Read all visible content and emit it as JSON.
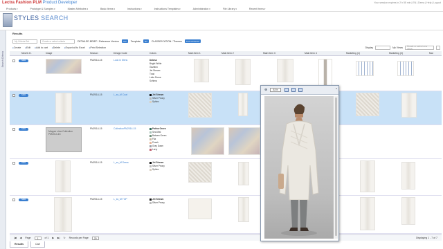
{
  "app": {
    "brand": "Lectra Fashion PLM",
    "product": "Product Developer",
    "top_links": "Your session expires in 2 h 55 min  |  EN  |  Demo  |  Help  |  Logout"
  },
  "menu": [
    "Products",
    "Prototype & Samples",
    "Master Attributes",
    "Basic Items",
    "Instructions",
    "Instructions Templates",
    "Administration",
    "File Library",
    "Recent Items"
  ],
  "page": {
    "title_a": "STYLES",
    "title_b": "SEARCH",
    "results_label": "Results",
    "sidebar_label": "Search Criteria"
  },
  "filters": {
    "criteria_placeholder": "My Criteria Set",
    "select_placeholder": "Create or select criteria",
    "brief_label": "DETAILED BRIEF / Reference Version",
    "brief_badge": "Yes",
    "template_label": "Template",
    "template_badge": "No",
    "classification_label": "CLASSIFICATION / Themes",
    "classification_badge": "Look at theme"
  },
  "toolbar": [
    "Create",
    "Edit",
    "Add to cart",
    "Delete",
    "Export all to Excel",
    "Print Selection"
  ],
  "right_controls": {
    "display": "Display",
    "my_views": "My Views",
    "views_placeholder": "Create or select new views"
  },
  "columns": [
    "New/C.D.",
    "Image",
    "Season",
    "Design Code",
    "Colors",
    "Main Item 1",
    "Main Item 2",
    "Main Item 3",
    "Main Item 4",
    "Marketing (1)",
    "Marketing (2)",
    "Mar"
  ],
  "rows": [
    {
      "new": "NEW",
      "season": "PM2014-15",
      "code": "Look in Mens",
      "colors": [
        "Dobruz",
        "Bright White",
        "Gaziano",
        "Jet Stream",
        "Trust",
        "Lotte Roma",
        "Schima"
      ],
      "selected": false
    },
    {
      "new": "NEW",
      "season": "PM2014-15",
      "code": "L_ss_M Coat",
      "colors": [
        "Jet Stream",
        "Silver Peony",
        "Sphinx"
      ],
      "selected": true
    },
    {
      "new": "NEW",
      "season": "PM2014-15",
      "code": "CollectionPM2014-15",
      "colors": [
        "Patina Green",
        "Sea Mist",
        "Balsam Green",
        "Fila",
        "Peach",
        "Gray Dawn",
        "Lorry"
      ],
      "selected": false,
      "placeholder": "Mapper view  Collection PM2014-15"
    },
    {
      "new": "NEW",
      "season": "PM2014-15",
      "code": "L_ss_M Dress",
      "colors": [
        "Jet Stream",
        "Silver Peony",
        "Sphinx"
      ],
      "selected": false
    },
    {
      "new": "NEW",
      "season": "PM2014-15",
      "code": "L_ss_M TOP",
      "colors": [
        "Jet Stream",
        "Silver Peony"
      ],
      "selected": false
    }
  ],
  "status": {
    "page_label": "Page",
    "page_value": "1",
    "of_label": "of 1",
    "per_page_label": "Records per Page",
    "per_page_value": "20",
    "displaying": "Displaying 1 - 7 of 7"
  },
  "tabs": [
    "Results",
    "Cart"
  ],
  "viewer": {
    "zoom": "81%",
    "close": "x"
  },
  "colors": {
    "accent": "#3a7fd0",
    "selected_row": "#c8e1f7",
    "brand": "#cc3333"
  }
}
